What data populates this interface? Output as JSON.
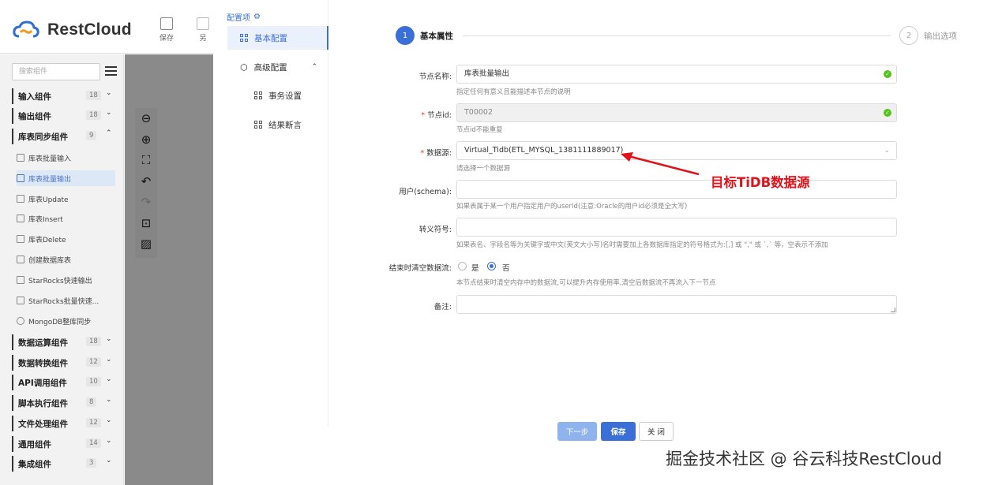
{
  "app": {
    "logo_text": "RestCloud"
  },
  "toolbar": {
    "save_label": "保存",
    "second_label": "另"
  },
  "sidebar": {
    "search_placeholder": "搜索组件",
    "categories": [
      {
        "label": "输入组件",
        "count": "18"
      },
      {
        "label": "输出组件",
        "count": "18"
      },
      {
        "label": "库表同步组件",
        "count": "9"
      },
      {
        "label": "数据运算组件",
        "count": "18"
      },
      {
        "label": "数据转换组件",
        "count": "12"
      },
      {
        "label": "API调用组件",
        "count": "10"
      },
      {
        "label": "脚本执行组件",
        "count": "8"
      },
      {
        "label": "文件处理组件",
        "count": "12"
      },
      {
        "label": "通用组件",
        "count": "14"
      },
      {
        "label": "集成组件",
        "count": "3"
      }
    ],
    "components": [
      "库表批量输入",
      "库表批量输出",
      "库表Update",
      "库表Insert",
      "库表Delete",
      "创建数据库表",
      "StarRocks快速输出",
      "StarRocks批量快速...",
      "MongoDB整库同步"
    ]
  },
  "config": {
    "title": "配置项",
    "nav": {
      "basic": "基本配置",
      "advanced": "高级配置",
      "transaction": "事务设置",
      "assertion": "结果断言"
    }
  },
  "steps": {
    "step1_num": "1",
    "step1_label": "基本属性",
    "step2_num": "2",
    "step2_label": "输出选项"
  },
  "form": {
    "node_name": {
      "label": "节点名称:",
      "value": "库表批量输出",
      "hint": "指定任何有意义且能描述本节点的说明"
    },
    "node_id": {
      "label": "节点id:",
      "value": "T00002",
      "hint": "节点id不能重复"
    },
    "datasource": {
      "label": "数据源:",
      "value": "Virtual_Tidb(ETL_MYSQL_1381111889017)",
      "hint": "请选择一个数据源"
    },
    "schema": {
      "label": "用户(schema):",
      "value": "",
      "hint": "如果表属于某一个用户指定用户的userId(注意:Oracle的用户id必须是全大写)"
    },
    "escape": {
      "label": "转义符号:",
      "value": "",
      "hint": "如果表名、字段名等为关键字或中文(英文大小写)名时需要加上各数据库指定的符号格式为:[,] 或 \",\" 或 `,` 等，空表示不添加"
    },
    "clear_stream": {
      "label": "结束时清空数据流:",
      "yes": "是",
      "no": "否",
      "selected": "否",
      "hint": "本节点结束时清空内存中的数据流,可以提升内存使用率,清空后数据流不再流入下一节点"
    },
    "remark": {
      "label": "备注:",
      "value": ""
    }
  },
  "annotation": "目标TiDB数据源",
  "buttons": {
    "next": "下一步",
    "save": "保存",
    "close": "关 闭"
  },
  "watermark": "掘金技术社区 @ 谷云科技RestCloud"
}
